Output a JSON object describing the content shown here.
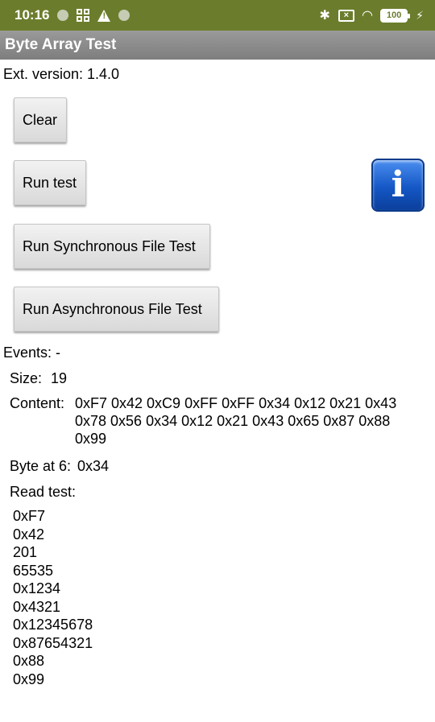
{
  "status_bar": {
    "time": "10:16",
    "battery": "100",
    "icons": [
      "notification-dot-icon",
      "grid-icon",
      "warning-icon",
      "notification-dot-icon",
      "bluetooth-icon",
      "sim-icon",
      "wifi-icon",
      "battery-icon",
      "charging-icon"
    ]
  },
  "title_bar": {
    "title": "Byte Array Test"
  },
  "ext_version": "Ext. version: 1.4.0",
  "buttons": {
    "clear": "Clear",
    "run_test": "Run test",
    "sync_file_test": "Run Synchronous File Test",
    "async_file_test": "Run Asynchronous File Test"
  },
  "info_icon": {
    "glyph": "i"
  },
  "events": "Events: -",
  "size": {
    "label": "Size:",
    "value": "19"
  },
  "content": {
    "label": "Content:",
    "lines": [
      "0xF7 0x42 0xC9 0xFF 0xFF 0x34 0x12 0x21 0x43",
      "0x78 0x56 0x34 0x12 0x21 0x43 0x65 0x87 0x88",
      "0x99"
    ]
  },
  "byte_at": {
    "label": "Byte at 6:",
    "value": "0x34"
  },
  "read_test": {
    "label": "Read test:",
    "values": [
      "0xF7",
      "0x42",
      "201",
      "65535",
      "0x1234",
      "0x4321",
      "0x12345678",
      "0x87654321",
      "0x88",
      "0x99"
    ]
  },
  "colors": {
    "status_bar": "#6b7d2c",
    "title_bar": "#8a8a8a",
    "button": "#e6e6e6",
    "info_icon": "#1457c5"
  }
}
